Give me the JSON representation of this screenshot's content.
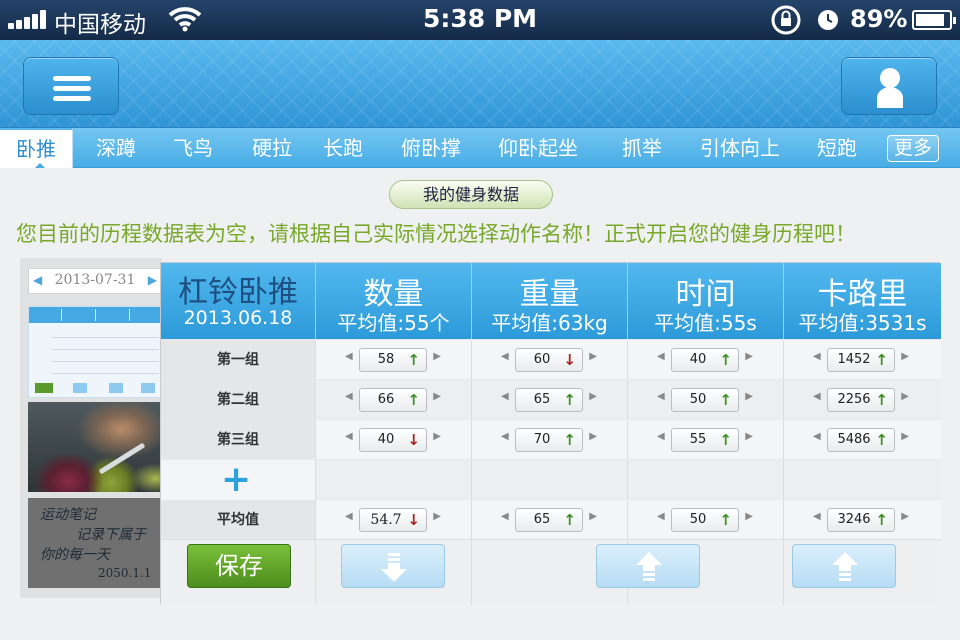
{
  "status_bar": {
    "carrier": "中国移动",
    "time": "5:38 PM",
    "battery_pct": "89%",
    "battery_level": 0.89
  },
  "header": {
    "menu_icon": "hamburger-menu-icon",
    "user_icon": "user-profile-icon"
  },
  "tabs": [
    {
      "label": "卧推",
      "active": true
    },
    {
      "label": "深蹲"
    },
    {
      "label": "飞鸟"
    },
    {
      "label": "硬拉"
    },
    {
      "label": "长跑"
    },
    {
      "label": "俯卧撑"
    },
    {
      "label": "仰卧起坐"
    },
    {
      "label": "抓举"
    },
    {
      "label": "引体向上"
    },
    {
      "label": "短跑"
    }
  ],
  "more_label": "更多",
  "data_pill": "我的健身数据",
  "message": "您目前的历程数据表为空，请根据自己实际情况选择动作名称！正式开启您的健身历程吧！",
  "sidebar": {
    "date": "2013-07-31",
    "notes": {
      "line1": "运动笔记",
      "line2": "记录下属于",
      "line3": "你的每一天",
      "line4": "2050.1.1"
    }
  },
  "table": {
    "exercise": "杠铃卧推",
    "date": "2013.06.18",
    "columns": [
      {
        "title": "数量",
        "avg": "平均值:55个"
      },
      {
        "title": "重量",
        "avg": "平均值:63kg"
      },
      {
        "title": "时间",
        "avg": "平均值:55s"
      },
      {
        "title": "卡路里",
        "avg": "平均值:3531s"
      }
    ],
    "rows": [
      {
        "label": "第一组",
        "values": [
          "58",
          "60",
          "40",
          "1452"
        ],
        "trends": [
          "up",
          "down",
          "up",
          "up"
        ]
      },
      {
        "label": "第二组",
        "values": [
          "66",
          "65",
          "50",
          "2256"
        ],
        "trends": [
          "up",
          "up",
          "up",
          "up"
        ]
      },
      {
        "label": "第三组",
        "values": [
          "40",
          "70",
          "55",
          "5486"
        ],
        "trends": [
          "down",
          "up",
          "up",
          "up"
        ]
      }
    ],
    "average_row": {
      "label": "平均值",
      "values": [
        "54.7",
        "65",
        "50",
        "3246"
      ],
      "trends": [
        "down",
        "up",
        "up",
        "up"
      ]
    },
    "add_icon": "plus-icon"
  },
  "save_label": "保存",
  "trend_glyphs": {
    "up": "↑",
    "down": "↓"
  }
}
